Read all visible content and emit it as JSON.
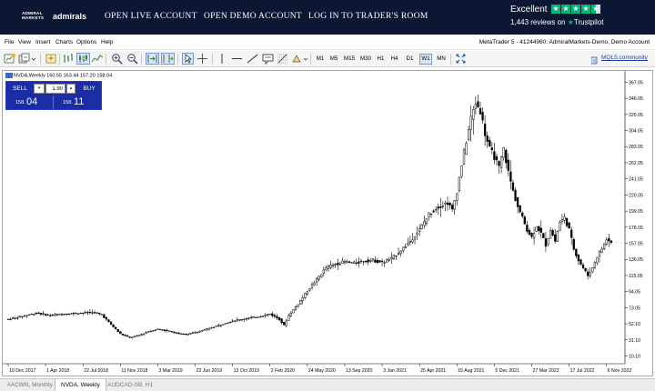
{
  "banner": {
    "logo_mark_top": "ADMIRAL",
    "logo_mark_bottom": "MARKETS",
    "logo_word": "admirals",
    "links": [
      "OPEN LIVE ACCOUNT",
      "OPEN DEMO ACCOUNT",
      "LOG IN TO TRADER'S ROOM"
    ],
    "trustpilot": {
      "rating_text": "Excellent",
      "stars": 4.5,
      "reviews_text": "1,443 reviews on",
      "brand": "Trustpilot"
    }
  },
  "menu": {
    "items": [
      "File",
      "View",
      "Insert",
      "Charts",
      "Options",
      "Help"
    ],
    "account_info": "MetaTrader 5 - 41244960: AdmiralMarkets-Demo, Demo Account"
  },
  "toolbar": {
    "timeframes": [
      "M1",
      "M5",
      "M15",
      "M30",
      "H1",
      "H4",
      "D1",
      "W1",
      "MN"
    ],
    "active_timeframe": "W1",
    "mql5_link": "MQL5.community"
  },
  "chart": {
    "title": "NVDA,Weekly  160.55 163.44 157.20 158.04",
    "trade_panel": {
      "sell_label": "SELL",
      "buy_label": "BUY",
      "lot": "1.90",
      "sell_price_small": "158.",
      "sell_price_big": "04",
      "buy_price_small": "158.",
      "buy_price_big": "11"
    }
  },
  "chart_data": {
    "type": "candlestick",
    "symbol": "NVDA",
    "timeframe": "Weekly",
    "ohlc": {
      "open": 160.55,
      "high": 163.44,
      "low": 157.2,
      "close": 158.04
    },
    "ylim": [
      0,
      377
    ],
    "y_ticks": [
      10.1,
      31.1,
      52.1,
      73.05,
      94.05,
      115.05,
      136.05,
      157.05,
      178.05,
      199.05,
      220.05,
      241.05,
      262.05,
      283.05,
      304.05,
      325.05,
      346.05,
      367.05
    ],
    "x_tick_labels": [
      "10 Dec 2017",
      "1 Apr 2018",
      "22 Jul 2018",
      "11 Nov 2018",
      "3 Mar 2019",
      "23 Jun 2019",
      "13 Oct 2019",
      "2 Feb 2020",
      "24 May 2020",
      "13 Sep 2020",
      "3 Jan 2021",
      "25 Apr 2021",
      "15 Aug 2021",
      "5 Dec 2021",
      "27 Mar 2022",
      "17 Jul 2022",
      "6 Nov 2022"
    ],
    "x_tick_weeks": [
      0,
      16,
      32,
      48,
      64,
      80,
      96,
      112,
      128,
      144,
      160,
      176,
      192,
      208,
      224,
      240,
      256
    ],
    "price_path": [
      [
        0,
        58
      ],
      [
        6,
        62
      ],
      [
        12,
        66
      ],
      [
        18,
        63
      ],
      [
        24,
        65
      ],
      [
        30,
        66
      ],
      [
        36,
        67
      ],
      [
        40,
        64
      ],
      [
        44,
        51
      ],
      [
        48,
        39
      ],
      [
        52,
        34
      ],
      [
        56,
        37
      ],
      [
        60,
        42
      ],
      [
        64,
        45
      ],
      [
        68,
        43
      ],
      [
        72,
        40
      ],
      [
        76,
        38
      ],
      [
        80,
        41
      ],
      [
        84,
        44
      ],
      [
        88,
        48
      ],
      [
        92,
        52
      ],
      [
        96,
        56
      ],
      [
        100,
        58
      ],
      [
        104,
        60
      ],
      [
        108,
        62
      ],
      [
        112,
        65
      ],
      [
        116,
        58
      ],
      [
        118,
        50
      ],
      [
        120,
        63
      ],
      [
        124,
        78
      ],
      [
        128,
        95
      ],
      [
        132,
        110
      ],
      [
        136,
        125
      ],
      [
        140,
        130
      ],
      [
        144,
        133
      ],
      [
        148,
        131
      ],
      [
        152,
        134
      ],
      [
        156,
        135
      ],
      [
        160,
        132
      ],
      [
        164,
        137
      ],
      [
        168,
        148
      ],
      [
        172,
        160
      ],
      [
        176,
        175
      ],
      [
        180,
        195
      ],
      [
        184,
        205
      ],
      [
        188,
        210
      ],
      [
        190,
        200
      ],
      [
        192,
        225
      ],
      [
        194,
        260
      ],
      [
        196,
        290
      ],
      [
        198,
        320
      ],
      [
        200,
        340
      ],
      [
        202,
        330
      ],
      [
        204,
        300
      ],
      [
        206,
        280
      ],
      [
        208,
        270
      ],
      [
        210,
        255
      ],
      [
        212,
        280
      ],
      [
        214,
        250
      ],
      [
        216,
        225
      ],
      [
        218,
        205
      ],
      [
        220,
        190
      ],
      [
        222,
        175
      ],
      [
        224,
        165
      ],
      [
        226,
        180
      ],
      [
        228,
        170
      ],
      [
        230,
        155
      ],
      [
        232,
        175
      ],
      [
        234,
        160
      ],
      [
        236,
        185
      ],
      [
        238,
        190
      ],
      [
        240,
        175
      ],
      [
        242,
        150
      ],
      [
        244,
        135
      ],
      [
        246,
        125
      ],
      [
        248,
        115
      ],
      [
        250,
        125
      ],
      [
        252,
        140
      ],
      [
        254,
        150
      ],
      [
        256,
        162
      ],
      [
        258,
        158
      ]
    ]
  },
  "tabs": {
    "items": [
      "#ACWN, Monthly",
      "NVDA, Weekly",
      "AUDCAD-SB, H1"
    ],
    "active": "NVDA, Weekly"
  }
}
